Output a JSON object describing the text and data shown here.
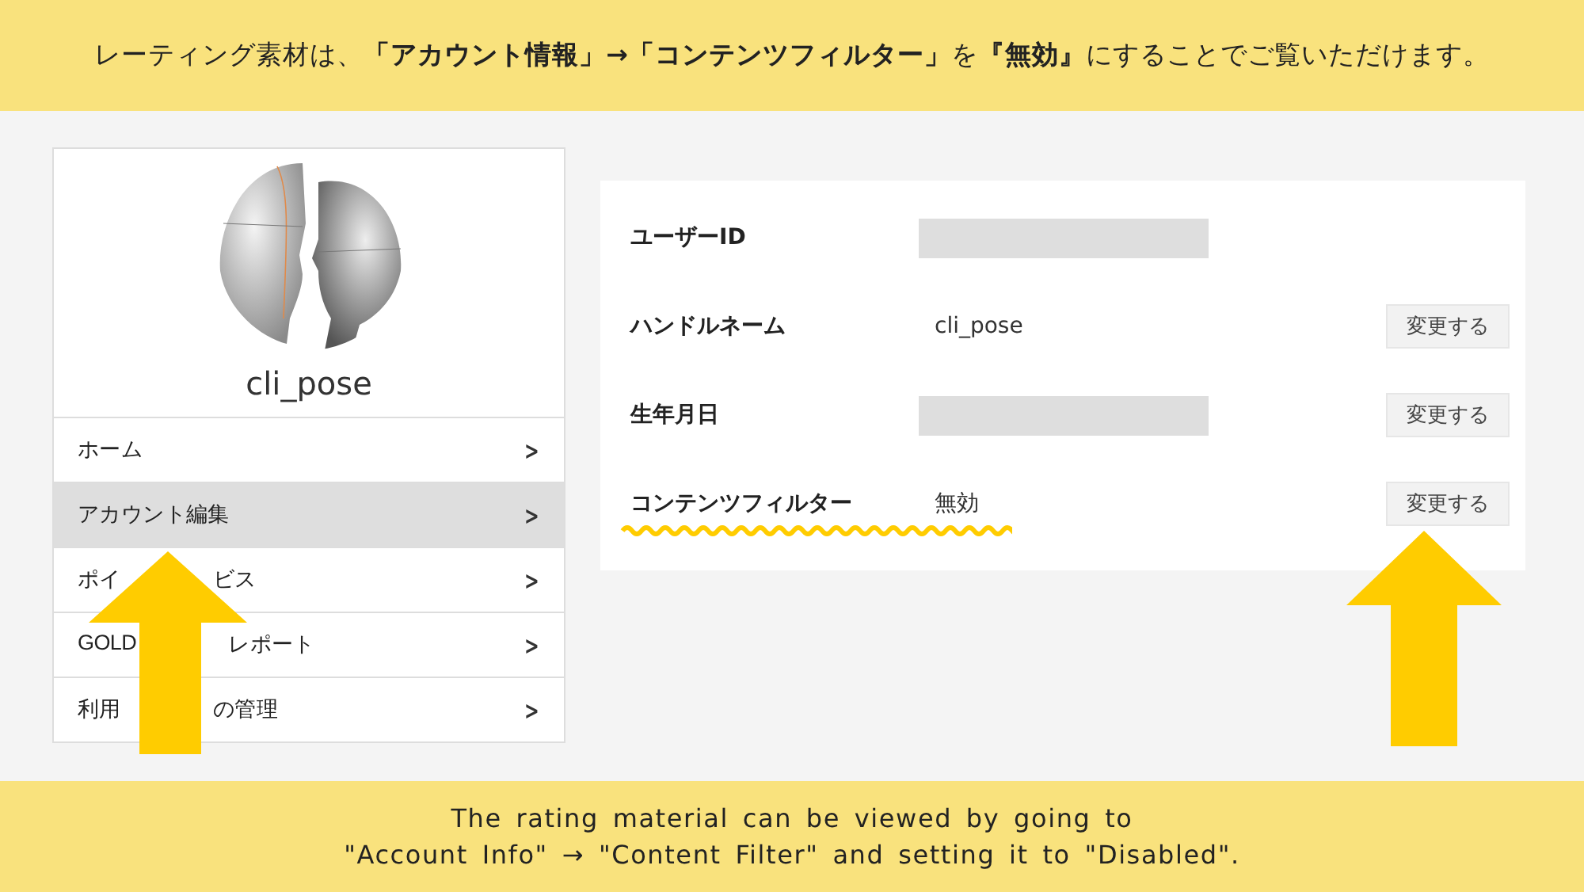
{
  "top_banner": {
    "text": "レーティング素材は、**「アカウント情報」→「コンテンツフィルター」**を**『無効』**にすることでご覧いただけます。"
  },
  "profile": {
    "name": "cli_pose"
  },
  "menu": [
    {
      "texts": [
        "ホーム"
      ],
      "selected": false,
      "chevron": ">"
    },
    {
      "texts": [
        "アカウント編集"
      ],
      "selected": true,
      "chevron": ">"
    },
    {
      "texts": [
        "ポイ",
        "ビス"
      ],
      "selected": false,
      "chevron": ">"
    },
    {
      "texts": [
        "GOLD",
        "レポート"
      ],
      "selected": false,
      "chevron": ">"
    },
    {
      "texts": [
        "利用",
        "の管理"
      ],
      "selected": false,
      "chevron": ">"
    }
  ],
  "account": {
    "rows": [
      {
        "label": "ユーザーID",
        "kind": "redacted"
      },
      {
        "label": "ハンドルネーム",
        "kind": "text",
        "value": "cli_pose",
        "button": "変更する"
      },
      {
        "label": "生年月日",
        "kind": "redacted",
        "button": "変更する"
      },
      {
        "label": "コンテンツフィルター",
        "kind": "text",
        "value": "無効",
        "button": "変更する",
        "underlined": true
      }
    ]
  },
  "bottom_banner": {
    "lines": [
      "The rating material can be viewed by going to",
      "\"Account Info\" → \"Content Filter\" and setting it to \"Disabled\"."
    ]
  }
}
